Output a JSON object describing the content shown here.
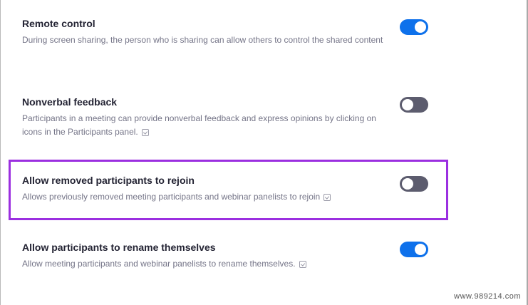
{
  "settings": [
    {
      "title": "Remote control",
      "description": "During screen sharing, the person who is sharing can allow others to control the shared content",
      "enabled": true,
      "has_info_icon": false
    },
    {
      "title": "Nonverbal feedback",
      "description": "Participants in a meeting can provide nonverbal feedback and express opinions by clicking on icons in the Participants panel.",
      "enabled": false,
      "has_info_icon": true
    },
    {
      "title": "Allow removed participants to rejoin",
      "description": "Allows previously removed meeting participants and webinar panelists to rejoin",
      "enabled": false,
      "has_info_icon": true
    },
    {
      "title": "Allow participants to rename themselves",
      "description": "Allow meeting participants and webinar panelists to rename themselves.",
      "enabled": true,
      "has_info_icon": true
    }
  ],
  "watermark": "www.989214.com",
  "colors": {
    "toggle_on": "#0e71eb",
    "toggle_off": "#5c5c6e",
    "highlight": "#9b2fe0"
  }
}
